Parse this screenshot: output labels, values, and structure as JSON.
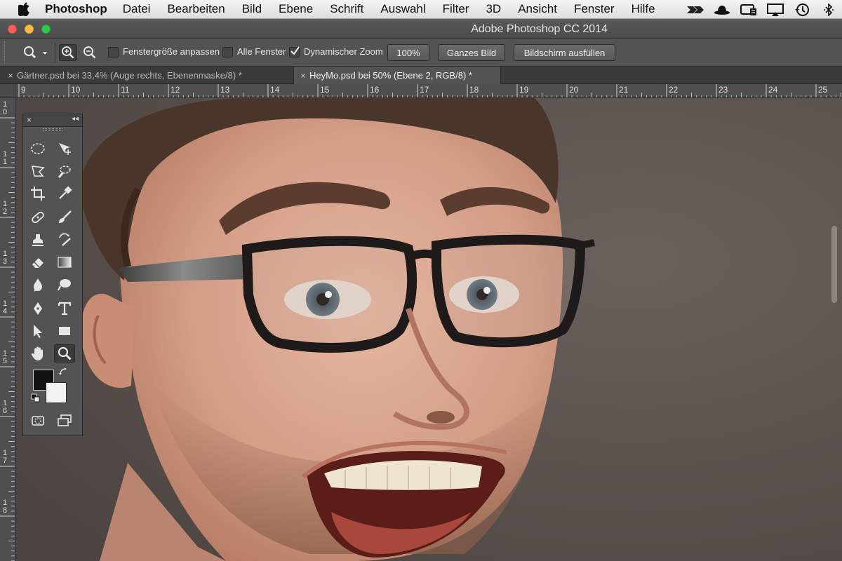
{
  "menubar": {
    "app_name": "Photoshop",
    "menus": [
      "Datei",
      "Bearbeiten",
      "Bild",
      "Ebene",
      "Schrift",
      "Auswahl",
      "Filter",
      "3D",
      "Ansicht",
      "Fenster",
      "Hilfe"
    ],
    "status_icons": [
      "zoom-icon",
      "bowler-hat-icon",
      "backup-icon",
      "airplay-icon",
      "time-machine-icon",
      "bluetooth-icon"
    ]
  },
  "window": {
    "title": "Adobe Photoshop CC 2014"
  },
  "options": {
    "fit_window_label": "Fenstergröße anpassen",
    "fit_window_checked": false,
    "all_windows_label": "Alle Fenster",
    "all_windows_checked": false,
    "scrubby_zoom_label": "Dynamischer Zoom",
    "scrubby_zoom_checked": true,
    "btn_100": "100%",
    "btn_fit": "Ganzes Bild",
    "btn_fill": "Bildschirm ausfüllen"
  },
  "tabs": [
    {
      "label": "Gärtner.psd bei 33,4% (Auge rechts, Ebenenmaske/8) *",
      "active": false
    },
    {
      "label": "HeyMo.psd bei 50% (Ebene 2, RGB/8) *",
      "active": true
    }
  ],
  "tab_close_glyph": "×",
  "ruler": {
    "h_numbers": [
      "9",
      "10",
      "11",
      "12",
      "13",
      "14",
      "15",
      "16",
      "17",
      "18",
      "19",
      "20",
      "21",
      "22",
      "23",
      "24",
      "25"
    ],
    "v_numbers": [
      [
        "1",
        "0"
      ],
      [
        "1",
        "1"
      ],
      [
        "1",
        "2"
      ],
      [
        "1",
        "3"
      ],
      [
        "1",
        "4"
      ],
      [
        "1",
        "5"
      ],
      [
        "1",
        "6"
      ],
      [
        "1",
        "7"
      ],
      [
        "1",
        "8"
      ]
    ]
  },
  "tools_panel": {
    "close_glyph": "×",
    "collapse_glyph": "◂◂",
    "foreground_color": "#111111",
    "background_color": "#f2f2f2"
  },
  "colors": {
    "app_bg": "#3c3c3c",
    "panel_bg": "#535353",
    "canvas_backdrop": "#5b524d"
  }
}
